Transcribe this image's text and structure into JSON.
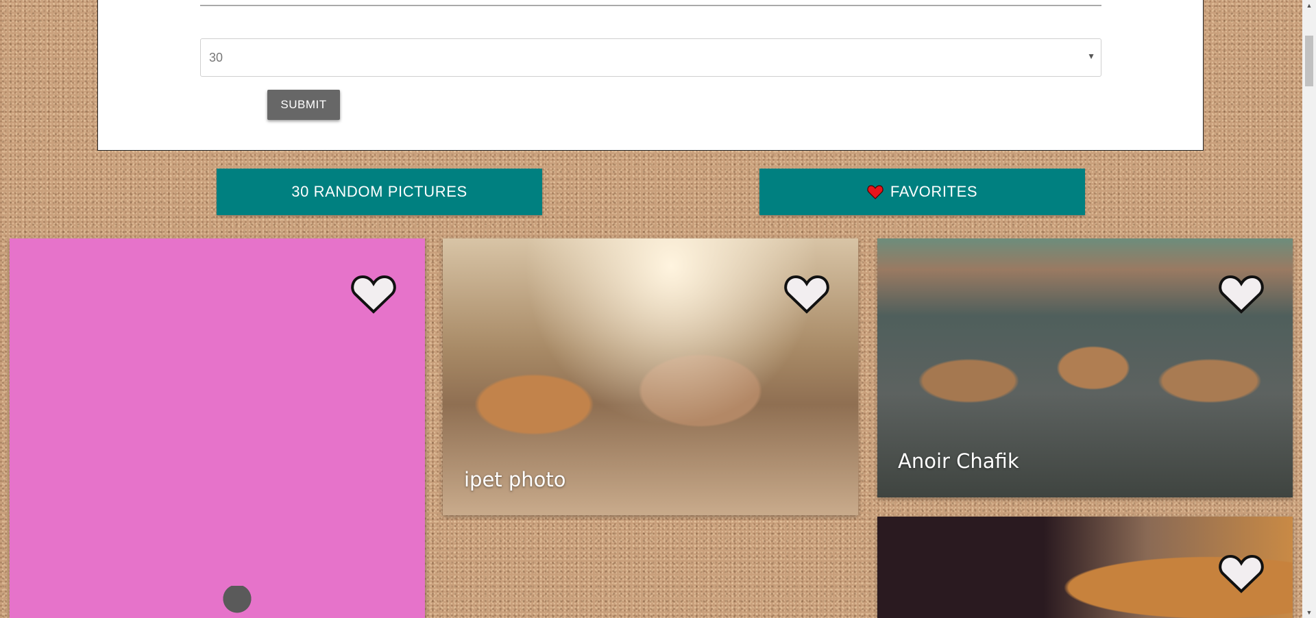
{
  "form": {
    "select_value": "30",
    "submit_label": "SUBMIT"
  },
  "nav": {
    "random_label": "30 RANDOM PICTURES",
    "favorites_label": "FAVORITES"
  },
  "cards": [
    {
      "credit": ""
    },
    {
      "credit": "ipet photo"
    },
    {
      "credit": "Anoir Chafik"
    },
    {
      "credit": ""
    }
  ],
  "colors": {
    "accent": "#008080",
    "submit": "#676767",
    "heart_red": "#e8141c"
  }
}
